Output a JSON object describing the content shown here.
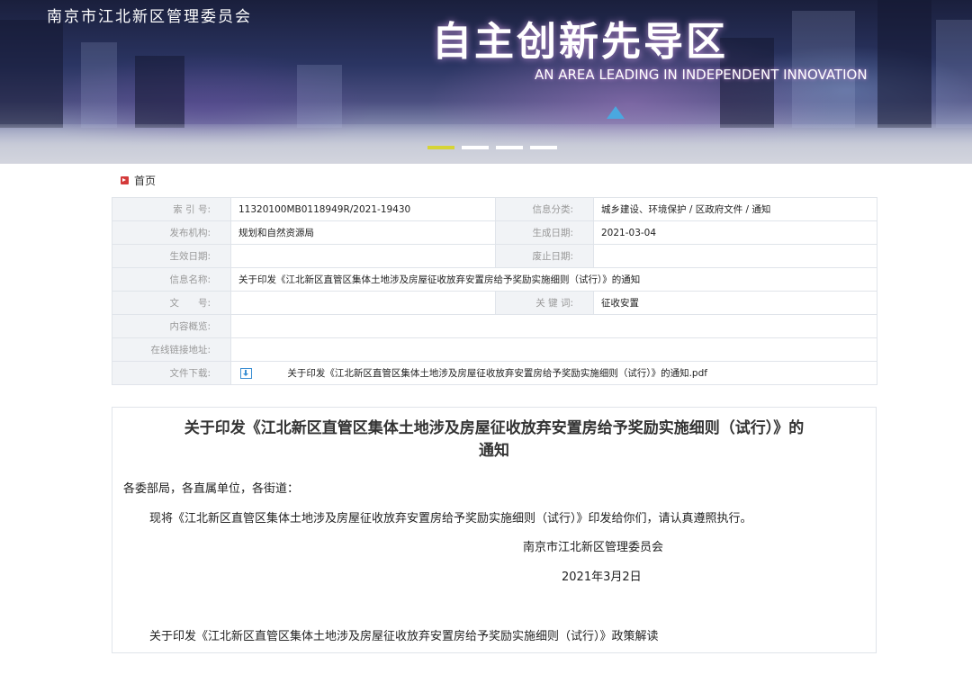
{
  "banner": {
    "gov_name": "南京市江北新区管理委员会",
    "slogan": "自主创新先导区",
    "slogan_en": "AN AREA LEADING IN INDEPENDENT INNOVATION",
    "slide_count": 4,
    "active_slide": 1,
    "colors": {
      "dot_active": "#d6d436",
      "dot": "#ffffff"
    }
  },
  "breadcrumb": {
    "home": "首页",
    "icon": "play-icon"
  },
  "info": {
    "index_label": "索 引 号:",
    "index_value": "11320100MB0118949R/2021-19430",
    "category_label": "信息分类:",
    "category_value": "城乡建设、环境保护 / 区政府文件 / 通知",
    "org_label": "发布机构:",
    "org_value": "规划和自然资源局",
    "gen_date_label": "生成日期:",
    "gen_date_value": "2021-03-04",
    "eff_date_label": "生效日期:",
    "eff_date_value": "",
    "exp_date_label": "废止日期:",
    "exp_date_value": "",
    "name_label": "信息名称:",
    "name_value": "关于印发《江北新区直管区集体土地涉及房屋征收放弃安置房给予奖励实施细则（试行）》的通知",
    "doc_no_label": "文　　号:",
    "doc_no_value": "",
    "keywords_label": "关 键 词:",
    "keywords_value": "征收安置",
    "summary_label": "内容概览:",
    "summary_value": "",
    "link_label": "在线链接地址:",
    "link_value": "",
    "download_label": "文件下载:",
    "download_file": "关于印发《江北新区直管区集体土地涉及房屋征收放弃安置房给予奖励实施细则（试行）》的通知.pdf",
    "download_icon": "download-icon"
  },
  "article": {
    "title_line1": "关于印发《江北新区直管区集体土地涉及房屋征收放弃安置房给予奖励实施细则（试行）》的",
    "title_line2": "通知",
    "salutation": "各委部局，各直属单位，各街道：",
    "body": "现将《江北新区直管区集体土地涉及房屋征收放弃安置房给予奖励实施细则（试行）》印发给你们，请认真遵照执行。",
    "signature": "南京市江北新区管理委员会",
    "date": "2021年3月2日",
    "related_link": "关于印发《江北新区直管区集体土地涉及房屋征收放弃安置房给予奖励实施细则（试行）》政策解读"
  }
}
